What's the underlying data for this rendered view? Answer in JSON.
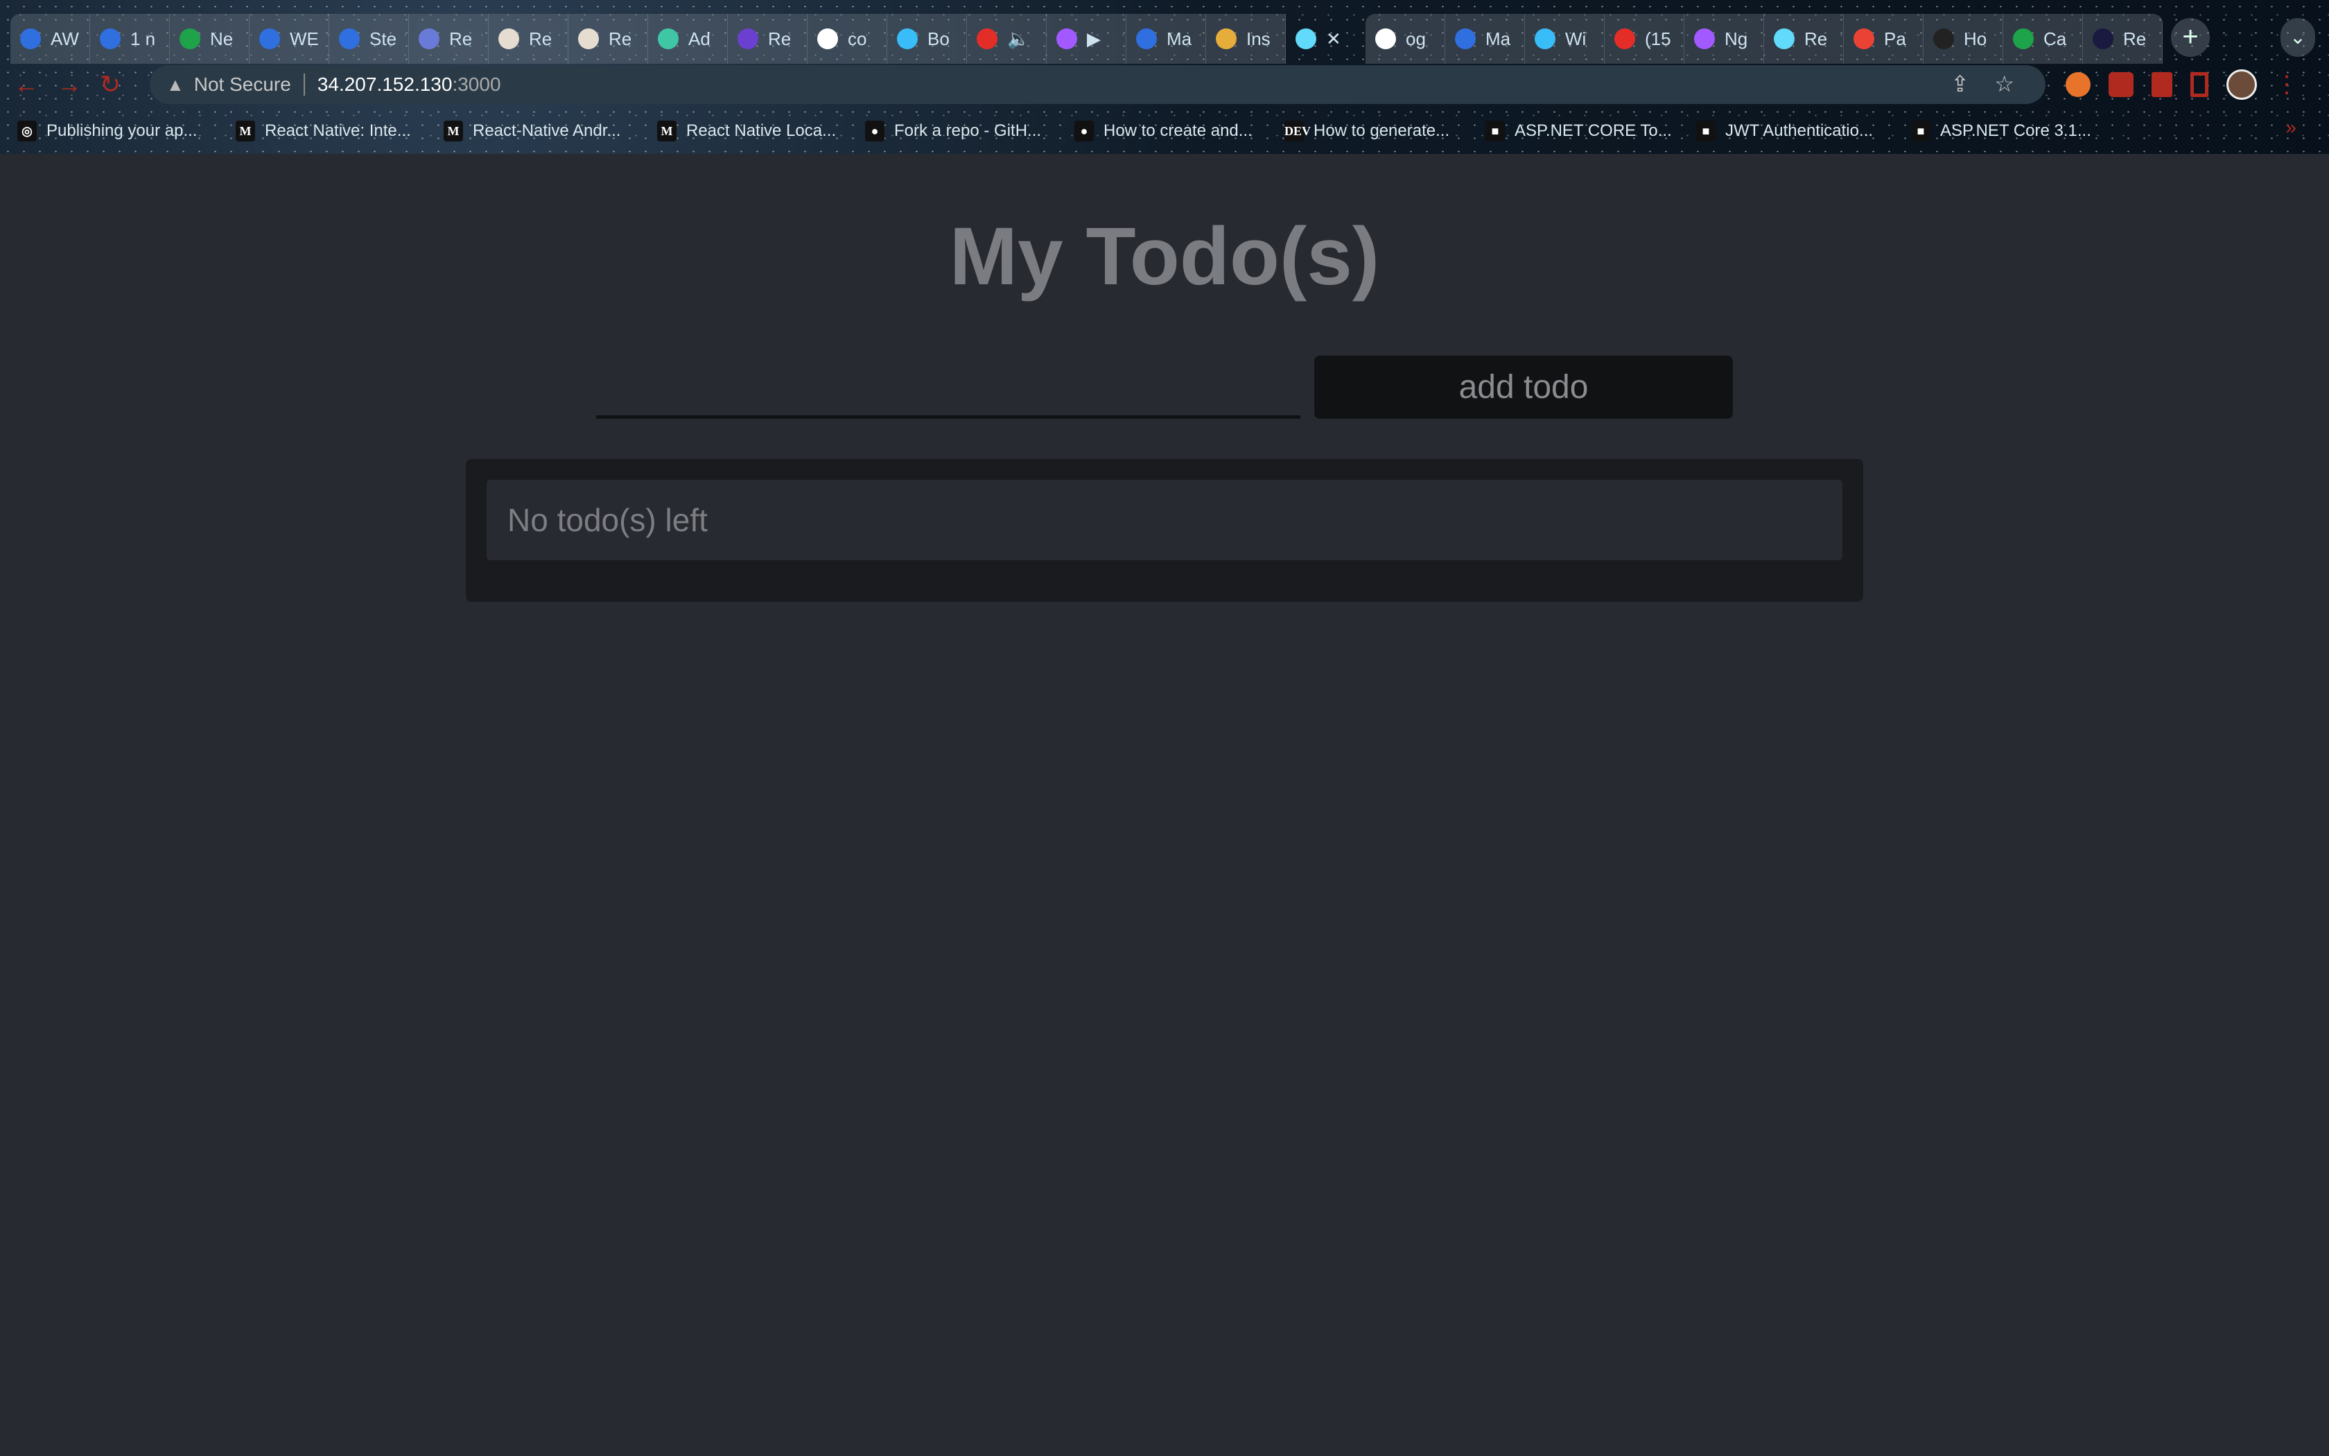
{
  "browser": {
    "tabs": [
      {
        "label": "AW",
        "color": "#2f6fe0"
      },
      {
        "label": "1 n",
        "color": "#2f6fe0"
      },
      {
        "label": "Ne",
        "color": "#1fa34a"
      },
      {
        "label": "WE",
        "color": "#2f6fe0"
      },
      {
        "label": "Ste",
        "color": "#2f6fe0"
      },
      {
        "label": "Re",
        "color": "#6a7ad8"
      },
      {
        "label": "Re",
        "color": "#e6ddd0"
      },
      {
        "label": "Re",
        "color": "#e6ddd0"
      },
      {
        "label": "Ad",
        "color": "#3fc7a5"
      },
      {
        "label": "Re",
        "color": "#6b3fd0"
      },
      {
        "label": "co",
        "color": "#ffffff"
      },
      {
        "label": "Bo",
        "color": "#38bdf8"
      },
      {
        "label": "🔈",
        "color": "#e52d27"
      },
      {
        "label": "▶",
        "color": "#a259ff"
      },
      {
        "label": "Ma",
        "color": "#2f6fe0"
      },
      {
        "label": "Ins",
        "color": "#e6ad3a"
      }
    ],
    "active_tab": {
      "close": "✕",
      "color": "#61dafb"
    },
    "tabs_after": [
      {
        "label": "og",
        "color": "#ffffff"
      },
      {
        "label": "Ma",
        "color": "#2f6fe0"
      },
      {
        "label": "Wi",
        "color": "#38bdf8"
      },
      {
        "label": "(15",
        "color": "#e52d27"
      },
      {
        "label": "Ng",
        "color": "#a259ff"
      },
      {
        "label": "Re",
        "color": "#61dafb"
      },
      {
        "label": "Pa",
        "color": "#ea4335"
      },
      {
        "label": "Ho",
        "color": "#222222"
      },
      {
        "label": "Ca",
        "color": "#1fa34a"
      },
      {
        "label": "Re",
        "color": "#1a1a40"
      }
    ],
    "new_tab": "+",
    "tab_menu": "⌄",
    "nav": {
      "back": "←",
      "forward": "→",
      "reload": "↻"
    },
    "address": {
      "warning": "▲",
      "security": "Not Secure",
      "host": "34.207.152.130",
      "port": ":3000"
    },
    "share": "⇪",
    "star": "☆",
    "menu": "⋮",
    "bookmarks": [
      {
        "label": "Publishing your ap...",
        "icon": "◎"
      },
      {
        "label": "React Native: Inte...",
        "icon": "M"
      },
      {
        "label": "React-Native Andr...",
        "icon": "M"
      },
      {
        "label": "React Native Loca...",
        "icon": "M"
      },
      {
        "label": "Fork a repo - GitH...",
        "icon": "●"
      },
      {
        "label": "How to create and...",
        "icon": "●"
      },
      {
        "label": "How to generate...",
        "icon": "DEV"
      },
      {
        "label": "ASP.NET CORE To...",
        "icon": "■"
      },
      {
        "label": "JWT Authenticatio...",
        "icon": "■"
      },
      {
        "label": "ASP.NET Core 3.1...",
        "icon": "■"
      }
    ],
    "bookmarks_more": "»"
  },
  "app": {
    "title": "My Todo(s)",
    "input": {
      "value": "",
      "placeholder": ""
    },
    "add_button": "add todo",
    "empty_message": "No todo(s) left"
  }
}
